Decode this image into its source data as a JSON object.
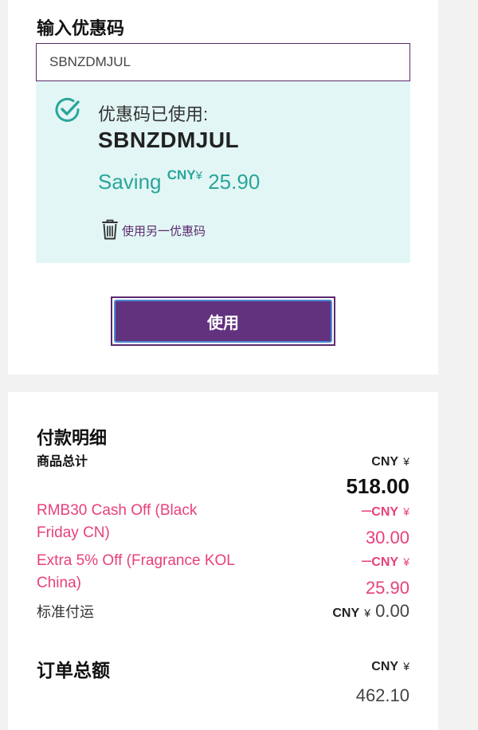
{
  "promo": {
    "title": "输入优惠码",
    "input_value": "SBNZDMJUL",
    "applied_label": "优惠码已使用:",
    "applied_code": "SBNZDMJUL",
    "saving_prefix": "Saving",
    "saving_currency": "CNY",
    "saving_yen": "¥",
    "saving_amount": "25.90",
    "use_another": "使用另一优惠码",
    "apply_button": "使用",
    "icons": [
      "check-circle-icon",
      "trash-icon"
    ],
    "colors": {
      "accent": "#62327f",
      "success": "#2aa59b",
      "applied_bg": "#e2f7f5"
    }
  },
  "summary": {
    "title": "付款明细",
    "subtotal": {
      "label": "商品总计",
      "currency": "CNY",
      "yen": "¥",
      "amount": "518.00"
    },
    "discounts": [
      {
        "label_line1": "RMB30 Cash Off (Black",
        "label_line2": "Friday CN)",
        "sign": "–",
        "currency": "CNY",
        "yen": "¥",
        "amount": "30.00"
      },
      {
        "label_line1": "Extra 5% Off (Fragrance KOL",
        "label_line2": "China)",
        "sign": "–",
        "currency": "CNY",
        "yen": "¥",
        "amount": "25.90"
      }
    ],
    "shipping": {
      "label": "标准付运",
      "currency": "CNY",
      "yen": "¥",
      "amount": "0.00"
    },
    "total": {
      "label": "订单总额",
      "currency": "CNY",
      "yen": "¥",
      "amount": "462.10"
    },
    "colors": {
      "discount": "#e8407d"
    }
  }
}
